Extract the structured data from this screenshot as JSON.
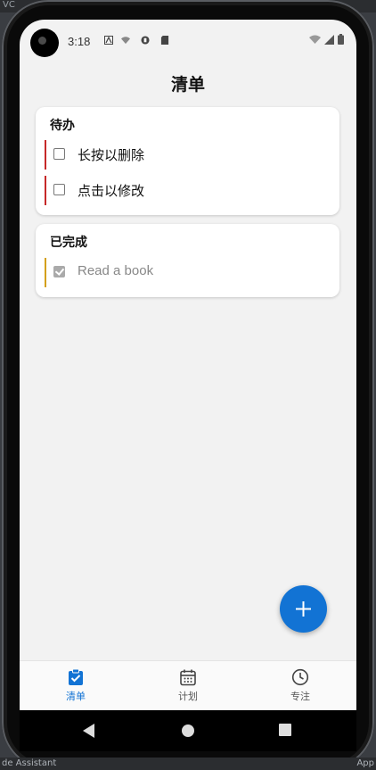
{
  "desktop": {
    "top_text": "VC",
    "bottom_left": "de Assistant",
    "bottom_right": "App"
  },
  "status_bar": {
    "time": "3:18"
  },
  "header": {
    "title": "清单"
  },
  "sections": [
    {
      "title": "待办",
      "items": [
        {
          "label": "长按以删除",
          "checked": false,
          "accent": "#c62828"
        },
        {
          "label": "点击以修改",
          "checked": false,
          "accent": "#c62828"
        }
      ]
    },
    {
      "title": "已完成",
      "items": [
        {
          "label": "Read a book",
          "checked": true,
          "accent": "#d4a017"
        }
      ]
    }
  ],
  "fab": {
    "icon": "plus-icon"
  },
  "bottom_nav": {
    "items": [
      {
        "label": "清单",
        "icon": "clipboard-check-icon",
        "active": true
      },
      {
        "label": "计划",
        "icon": "calendar-icon",
        "active": false
      },
      {
        "label": "专注",
        "icon": "clock-icon",
        "active": false
      }
    ]
  },
  "colors": {
    "primary": "#1273d4",
    "background": "#f2f2f2"
  }
}
